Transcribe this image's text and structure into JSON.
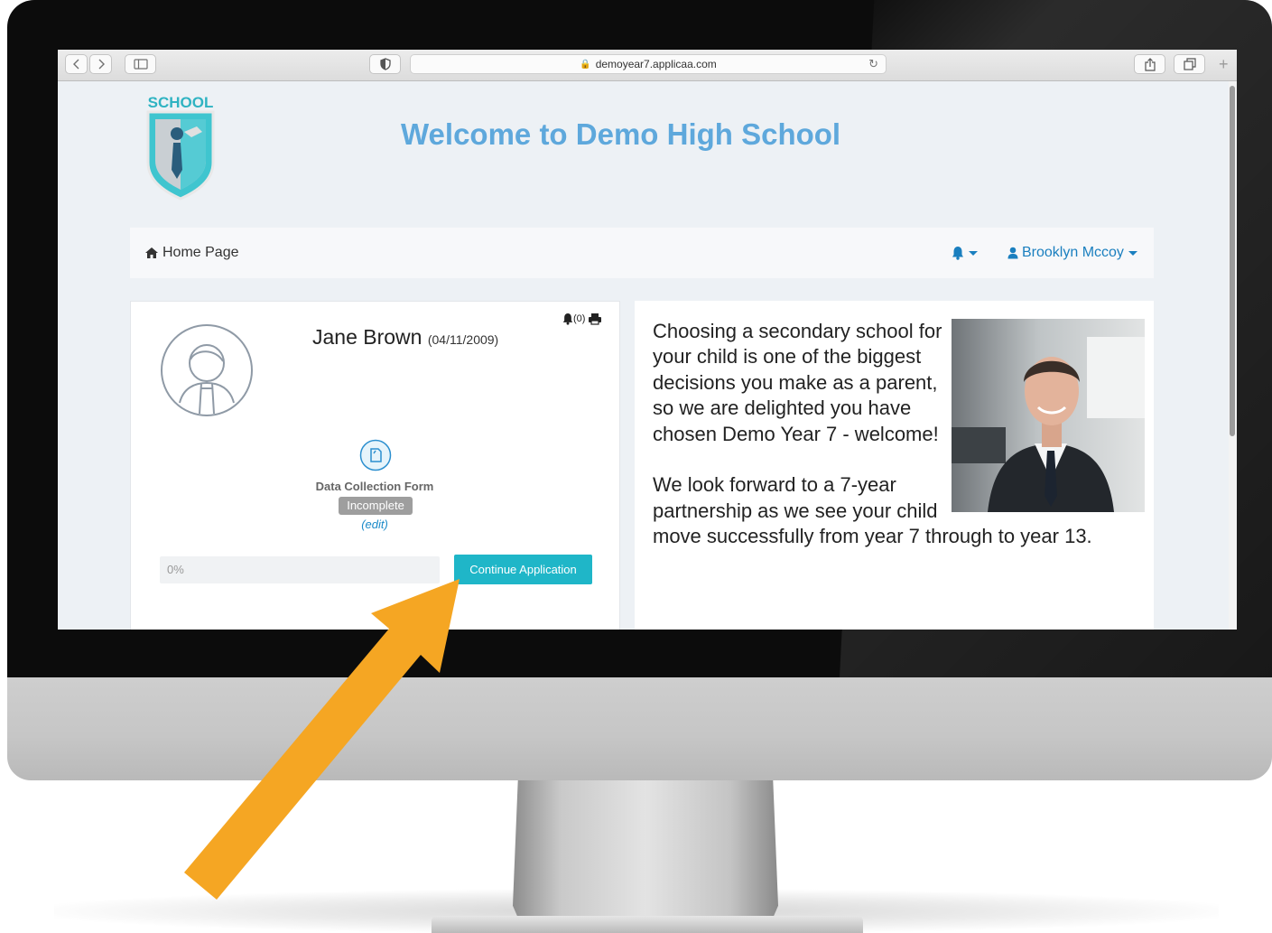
{
  "browser": {
    "url": "demoyear7.applicaa.com",
    "nav_buttons": [
      "back",
      "forward"
    ]
  },
  "site": {
    "logo_text": "SCHOOL",
    "title": "Welcome to Demo High School"
  },
  "navbar": {
    "home_label": "Home Page",
    "user_name": "Brooklyn Mccoy"
  },
  "student_card": {
    "name": "Jane Brown",
    "dob": "(04/11/2009)",
    "notification_count": "(0)",
    "form_title": "Data Collection Form",
    "form_status": "Incomplete",
    "edit_label": "(edit)",
    "progress_text": "0%",
    "progress_value": 0,
    "continue_label": "Continue Application"
  },
  "welcome_panel": {
    "paragraph_1": "Choosing a secondary school for your child is one of the biggest decisions you make as a parent, so we are delighted you have chosen Demo Year 7 - welcome!",
    "paragraph_2": "We look forward to a 7-year partnership as we see your child move successfully from year 7 through to year 13."
  },
  "colors": {
    "accent": "#1fb6c8",
    "title_blue": "#5ea8dc",
    "link_blue": "#1a7fbf",
    "badge_gray": "#9e9e9e",
    "arrow": "#f5a623"
  },
  "icons": [
    "home-icon",
    "bell-icon",
    "user-icon",
    "print-icon",
    "document-icon",
    "avatar-icon"
  ]
}
